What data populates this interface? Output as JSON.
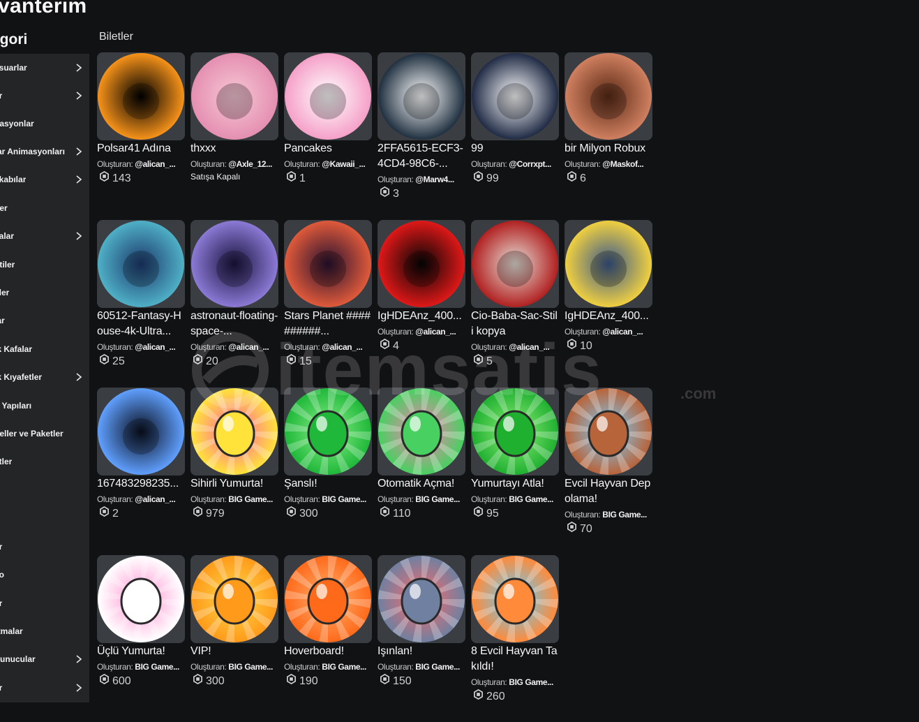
{
  "page": {
    "title": "avanterim",
    "category_heading": "egori",
    "section": "Biletler"
  },
  "sidebar": {
    "items": [
      {
        "label": "esuarlar",
        "chevron": true
      },
      {
        "label": "ar",
        "chevron": true
      },
      {
        "label": "nasyonlar",
        "chevron": false
      },
      {
        "label": "tar Animasyonları",
        "chevron": true
      },
      {
        "label": "kkabılar",
        "chevron": true
      },
      {
        "label": "der",
        "chevron": false
      },
      {
        "label": "yalar",
        "chevron": true
      },
      {
        "label": "ntiler",
        "chevron": false
      },
      {
        "label": "eler",
        "chevron": false
      },
      {
        "label": "lar",
        "chevron": false
      },
      {
        "label": "ik Kafalar",
        "chevron": false
      },
      {
        "label": "ik Kıyafetler",
        "chevron": true
      },
      {
        "label": "h Yapıları",
        "chevron": false
      },
      {
        "label": "deller ve Paketler",
        "chevron": false
      },
      {
        "label": "etler",
        "chevron": false
      },
      {
        "label": "er",
        "chevron": false
      },
      {
        "label": "eo",
        "chevron": false
      },
      {
        "label": "er",
        "chevron": false
      },
      {
        "label": "rtmalar",
        "chevron": false
      },
      {
        "label": " Sunucular",
        "chevron": true
      },
      {
        "label": "er",
        "chevron": true
      }
    ]
  },
  "creator_prefix": "Oluşturan: ",
  "items": [
    {
      "name": "Polsar41 Adına",
      "creator": "@alican_...",
      "price": "143",
      "icon": "tantana-shopy-logo"
    },
    {
      "name": "thxxx",
      "creator": "@Axle_12...",
      "status": "Satışa Kapalı",
      "icon": "pink-collage-image"
    },
    {
      "name": "Pancakes",
      "creator": "@Kawaii_...",
      "price": "1",
      "icon": "pancakes-image"
    },
    {
      "name": "2FFA5615-ECF3-4CD4-98C6-...",
      "creator": "@Marw4...",
      "price": "3",
      "icon": "anime-character-image"
    },
    {
      "name": "99",
      "creator": "@Corrxpt...",
      "price": "99",
      "icon": "roblox-avatar-image"
    },
    {
      "name": "bir Milyon Robux",
      "creator": "@Maskof...",
      "price": "6",
      "icon": "face-photo-image"
    },
    {
      "name": "60512-Fantasy-House-4k-Ultra...",
      "creator": "@alican_...",
      "price": "25",
      "icon": "fantasy-house-image"
    },
    {
      "name": "astronaut-floating-space-...",
      "creator": "@alican_...",
      "price": "20",
      "icon": "astronaut-image"
    },
    {
      "name": "Stars Planet ##########...",
      "creator": "@alican_...",
      "price": "15",
      "icon": "stars-planet-image"
    },
    {
      "name": "IgHDEAnz_400...",
      "creator": "@alican_...",
      "price": "4",
      "icon": "santa-pixel-image"
    },
    {
      "name": "Cio-Baba-Sac-Stili kopya",
      "creator": "@alican_...",
      "price": "5",
      "icon": "santa-hat-photo-image"
    },
    {
      "name": "IgHDEAnz_400...",
      "creator": "@alican_...",
      "price": "10",
      "icon": "coach-photo-image"
    },
    {
      "name": "167483298235...",
      "creator": "@alican_...",
      "price": "2",
      "icon": "keyboard-image"
    },
    {
      "name": "Sihirli Yumurta!",
      "creator": "BIG Game...",
      "price": "979",
      "icon": "magic-egg-icon"
    },
    {
      "name": "Şanslı!",
      "creator": "BIG Game...",
      "price": "300",
      "icon": "clover-icon"
    },
    {
      "name": "Otomatik Açma!",
      "creator": "BIG Game...",
      "price": "110",
      "icon": "auto-open-egg-icon"
    },
    {
      "name": "Yumurtayı Atla!",
      "creator": "BIG Game...",
      "price": "95",
      "icon": "skip-icon"
    },
    {
      "name": "Evcil Hayvan Depolama!",
      "creator": "BIG Game...",
      "price": "70",
      "icon": "backpack-icon"
    },
    {
      "name": "Üçlü Yumurta!",
      "creator": "BIG Game...",
      "price": "600",
      "icon": "triple-egg-icon"
    },
    {
      "name": "VIP!",
      "creator": "BIG Game...",
      "price": "300",
      "icon": "vip-crown-icon"
    },
    {
      "name": "Hoverboard!",
      "creator": "BIG Game...",
      "price": "190",
      "icon": "hoverboard-icon"
    },
    {
      "name": "Işınlan!",
      "creator": "BIG Game...",
      "price": "150",
      "icon": "teleport-joystick-icon"
    },
    {
      "name": "8 Evcil Hayvan Takıldı!",
      "creator": "BIG Game...",
      "price": "260",
      "icon": "corgi-pet-icon"
    }
  ],
  "watermark": "itemsatis.com",
  "colors": {
    "background": "#111214",
    "sidebar": "#232527",
    "card": "#3a3d42",
    "text": "#f7f7f8",
    "muted": "#c9cacc"
  }
}
